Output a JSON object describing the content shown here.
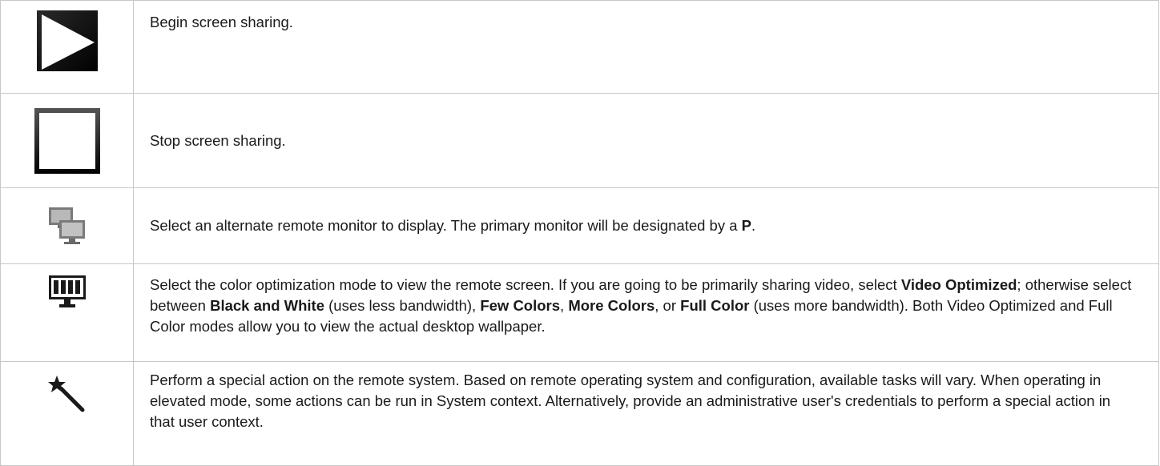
{
  "rows": [
    {
      "icon": "play-icon",
      "parts": [
        {
          "t": "Begin screen sharing.",
          "b": false
        }
      ]
    },
    {
      "icon": "stop-icon",
      "parts": [
        {
          "t": "Stop screen sharing.",
          "b": false
        }
      ]
    },
    {
      "icon": "multi-monitor-icon",
      "parts": [
        {
          "t": "Select an alternate remote monitor to display. The primary monitor will be designated by a ",
          "b": false
        },
        {
          "t": "P",
          "b": true
        },
        {
          "t": ".",
          "b": false
        }
      ]
    },
    {
      "icon": "color-mode-monitor-icon",
      "parts": [
        {
          "t": "Select the color optimization mode to view the remote screen. If you are going to be primarily sharing video, select ",
          "b": false
        },
        {
          "t": "Video Optimized",
          "b": true
        },
        {
          "t": "; otherwise select between ",
          "b": false
        },
        {
          "t": "Black and White",
          "b": true
        },
        {
          "t": " (uses less bandwidth), ",
          "b": false
        },
        {
          "t": "Few Colors",
          "b": true
        },
        {
          "t": ", ",
          "b": false
        },
        {
          "t": "More Colors",
          "b": true
        },
        {
          "t": ", or ",
          "b": false
        },
        {
          "t": "Full Color",
          "b": true
        },
        {
          "t": " (uses more bandwidth). Both Video Optimized and Full Color modes allow you to view the actual desktop wallpaper.",
          "b": false
        }
      ]
    },
    {
      "icon": "magic-wand-icon",
      "parts": [
        {
          "t": "Perform a special action on the remote system. Based on remote operating system and configuration, available tasks will vary. When operating in elevated mode, some actions can be run in System context. Alternatively, provide an administrative user's credentials to perform a special action in that user context.",
          "b": false
        }
      ]
    }
  ]
}
